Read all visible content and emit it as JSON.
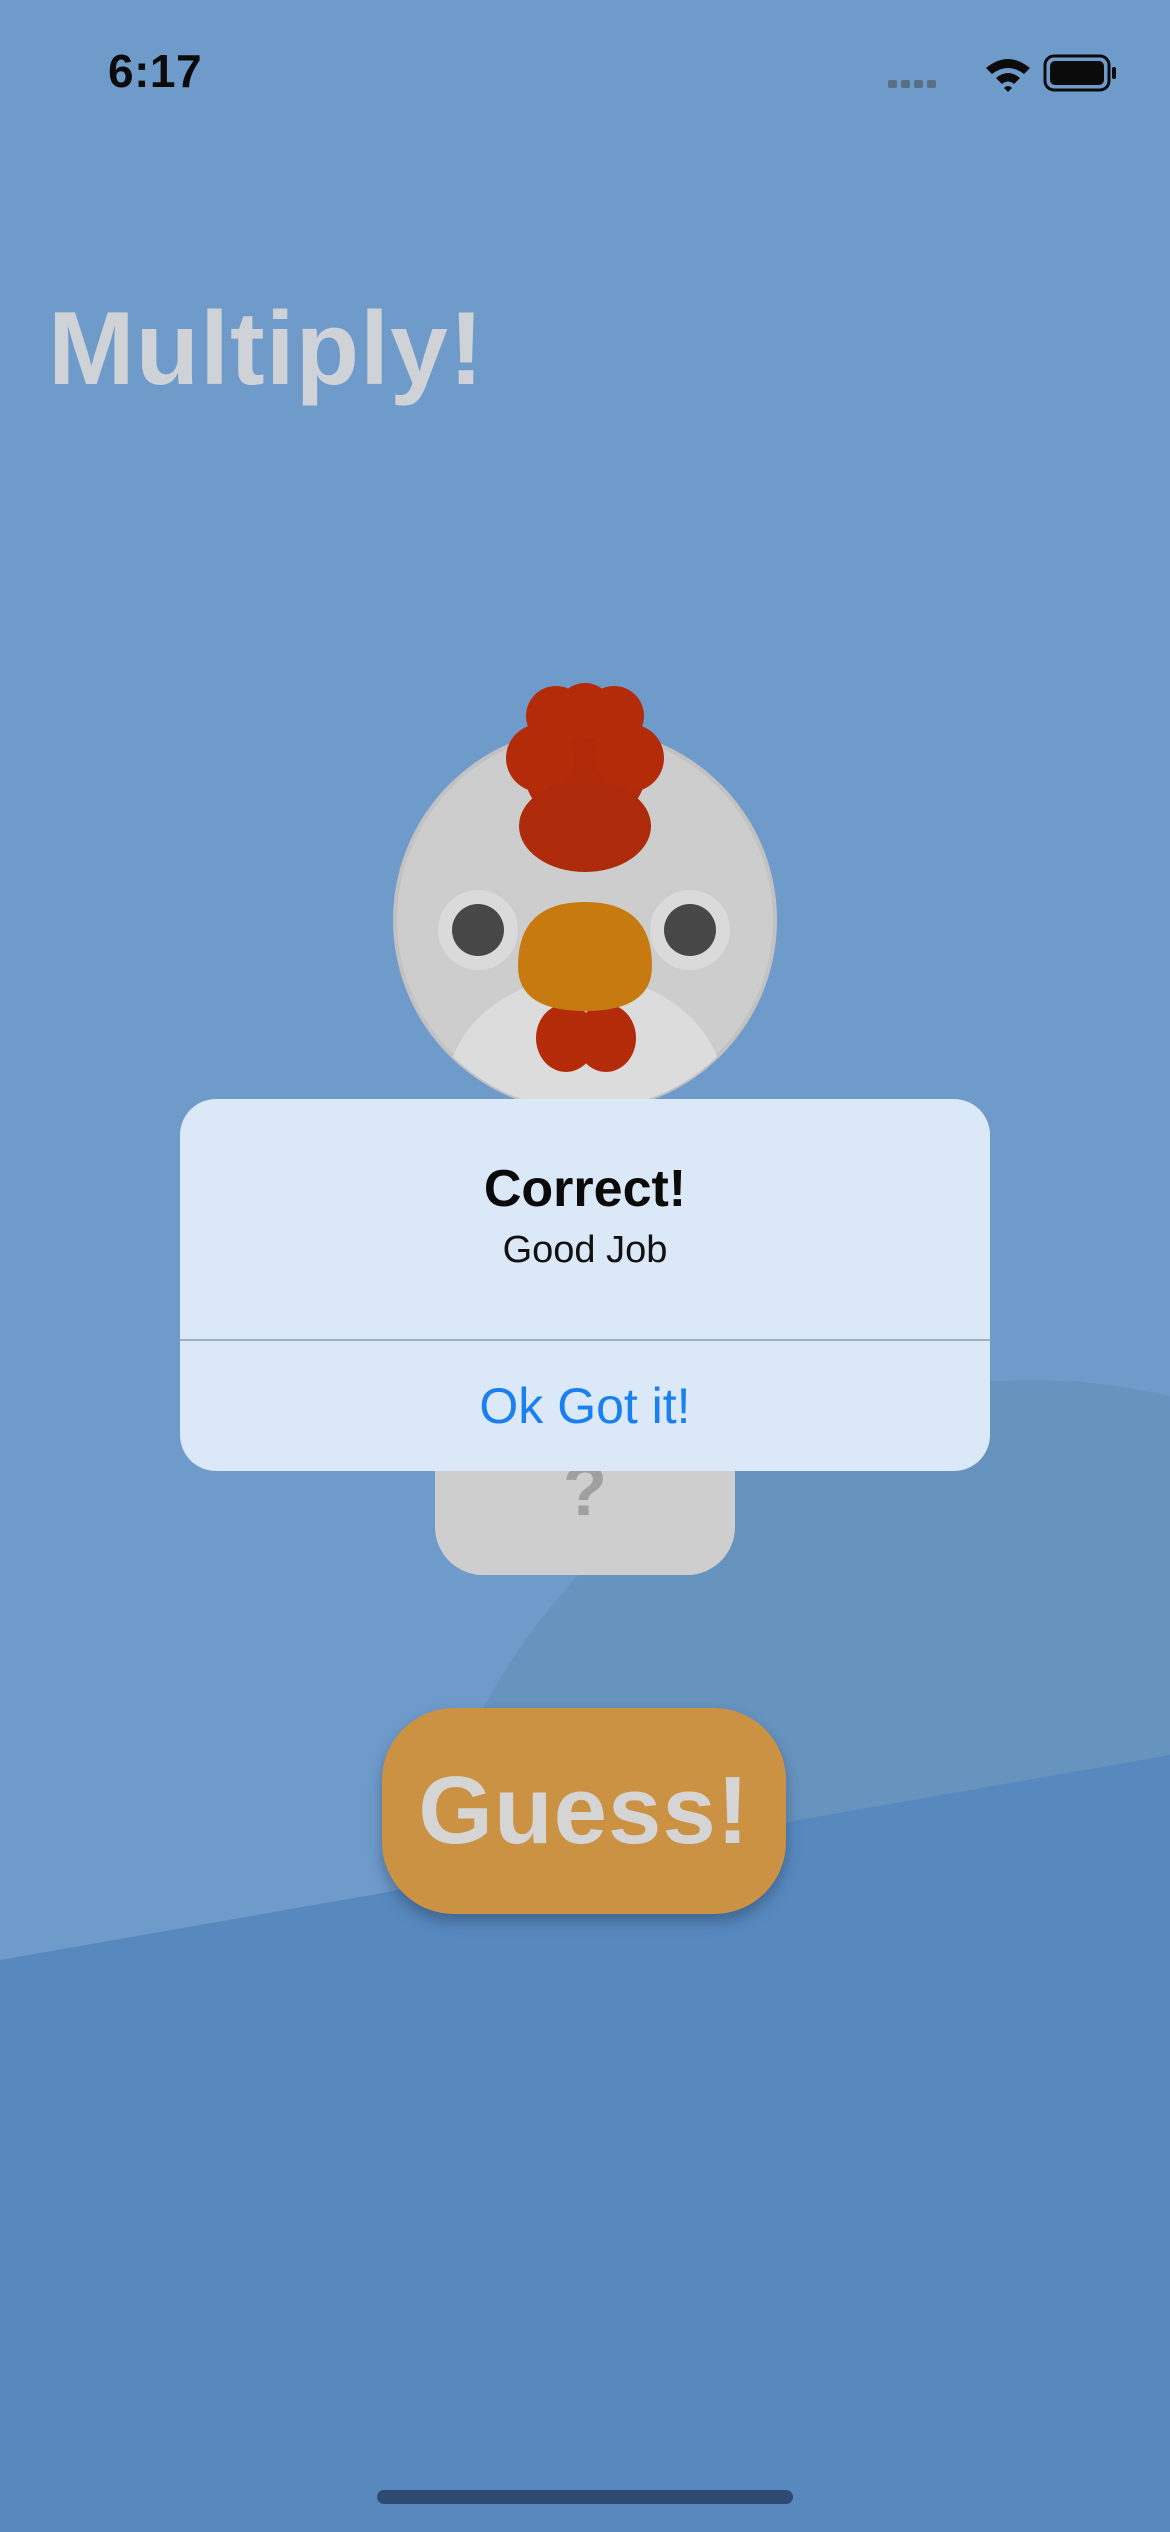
{
  "status_bar": {
    "time": "6:17"
  },
  "header": {
    "title": "Multiply!"
  },
  "question_card": {
    "answer": "?"
  },
  "guess_button": {
    "label": "Guess!"
  },
  "alert": {
    "title": "Correct!",
    "message": "Good Job",
    "action_label": "Ok Got it!"
  },
  "icons": {
    "avatar": "chicken-icon",
    "signal": "cellular-signal-icon",
    "wifi": "wifi-icon",
    "battery": "battery-icon"
  },
  "colors": {
    "background": "#6f9bcb",
    "button": "#cc9244",
    "alert_background": "#dae8f7",
    "alert_action": "#1a7ff0",
    "title_text": "#cfd2d6"
  }
}
